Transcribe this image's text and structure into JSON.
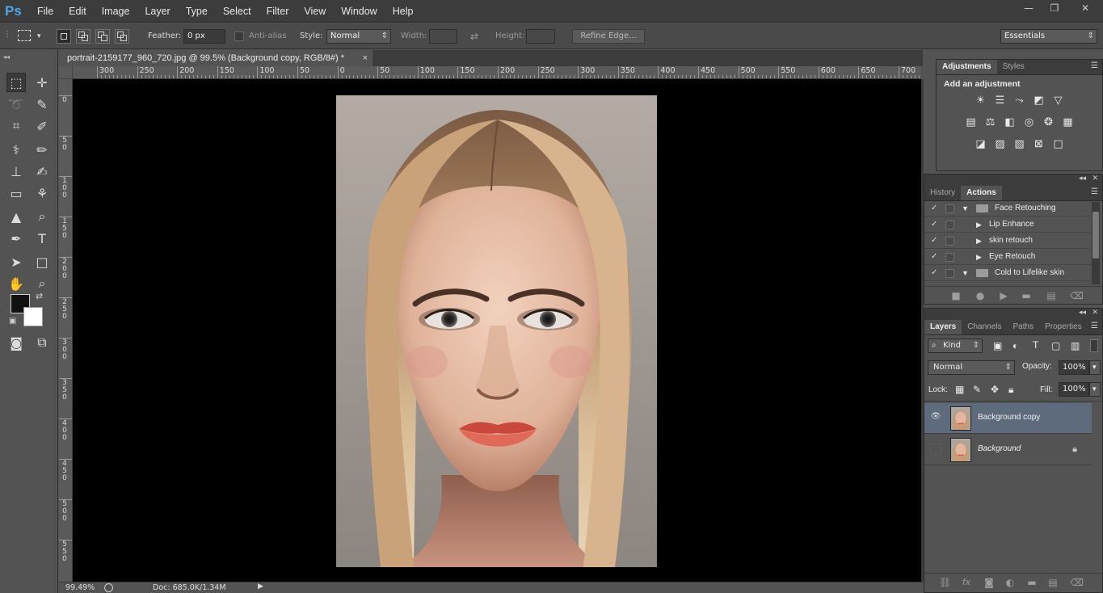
{
  "app": {
    "logo": "Ps"
  },
  "menu": [
    "File",
    "Edit",
    "Image",
    "Layer",
    "Type",
    "Select",
    "Filter",
    "View",
    "Window",
    "Help"
  ],
  "window_controls": {
    "minimize": "—",
    "restore": "❐",
    "close": "✕"
  },
  "options_bar": {
    "feather_label": "Feather:",
    "feather_value": "0 px",
    "antialias_label": "Anti-alias",
    "style_label": "Style:",
    "style_value": "Normal",
    "width_label": "Width:",
    "width_value": "",
    "height_label": "Height:",
    "height_value": "",
    "refine_edge": "Refine Edge...",
    "workspace": "Essentials"
  },
  "document": {
    "tab_title": "portrait-2159177_960_720.jpg @ 99.5% (Background copy, RGB/8#) *",
    "close": "×"
  },
  "ruler_h_labels": [
    "300",
    "250",
    "200",
    "150",
    "100",
    "50",
    "0",
    "50",
    "100",
    "150",
    "200",
    "250",
    "300",
    "350",
    "400",
    "450",
    "500",
    "550",
    "600",
    "650",
    "700"
  ],
  "ruler_v_labels": [
    "0",
    "5\n0",
    "1\n0\n0",
    "1\n5\n0",
    "2\n0\n0",
    "2\n5\n0",
    "3\n0\n0",
    "3\n5\n0",
    "4\n0\n0",
    "4\n5\n0",
    "5\n0\n0",
    "5\n5\n0"
  ],
  "status": {
    "zoom": "99.49%",
    "doc": "Doc: 685.0K/1.34M",
    "arrow": "▶"
  },
  "tools": [
    {
      "name": "rectangular-marquee-icon",
      "glyph": "⬚"
    },
    {
      "name": "move-icon",
      "glyph": "✛"
    },
    {
      "name": "lasso-icon",
      "glyph": "➰"
    },
    {
      "name": "quick-selection-icon",
      "glyph": "✎"
    },
    {
      "name": "crop-icon",
      "glyph": "⌗"
    },
    {
      "name": "eyedropper-icon",
      "glyph": "✐"
    },
    {
      "name": "spot-healing-icon",
      "glyph": "⚕"
    },
    {
      "name": "brush-icon",
      "glyph": "✏"
    },
    {
      "name": "clone-stamp-icon",
      "glyph": "⊥"
    },
    {
      "name": "history-brush-icon",
      "glyph": "✍"
    },
    {
      "name": "eraser-icon",
      "glyph": "▭"
    },
    {
      "name": "paint-bucket-icon",
      "glyph": "⚘"
    },
    {
      "name": "blur-icon",
      "glyph": "▲"
    },
    {
      "name": "dodge-icon",
      "glyph": "⌕"
    },
    {
      "name": "pen-icon",
      "glyph": "✒"
    },
    {
      "name": "type-icon",
      "glyph": "T"
    },
    {
      "name": "path-selection-icon",
      "glyph": "➤"
    },
    {
      "name": "rectangle-shape-icon",
      "glyph": "□"
    },
    {
      "name": "hand-icon",
      "glyph": "✋"
    },
    {
      "name": "zoom-icon",
      "glyph": "⌕"
    },
    {
      "name": "quick-mask-icon",
      "glyph": "◙"
    },
    {
      "name": "screen-mode-icon",
      "glyph": "⧉"
    }
  ],
  "colors": {
    "foreground": "#111111",
    "background": "#ffffff",
    "swap": "⇄",
    "default": "▣",
    "selected_layer": "#5d6b7d"
  },
  "adjustments": {
    "tabs": [
      "Adjustments",
      "Styles"
    ],
    "title": "Add an adjustment",
    "icons": [
      {
        "name": "brightness-contrast-icon",
        "glyph": "☀"
      },
      {
        "name": "levels-icon",
        "glyph": "☰"
      },
      {
        "name": "curves-icon",
        "glyph": "⤳"
      },
      {
        "name": "exposure-icon",
        "glyph": "◩"
      },
      {
        "name": "vibrance-icon",
        "glyph": "▽"
      },
      {
        "name": "hue-saturation-icon",
        "glyph": "▤"
      },
      {
        "name": "color-balance-icon",
        "glyph": "⚖"
      },
      {
        "name": "black-white-icon",
        "glyph": "◧"
      },
      {
        "name": "photo-filter-icon",
        "glyph": "◎"
      },
      {
        "name": "channel-mixer-icon",
        "glyph": "❂"
      },
      {
        "name": "color-lookup-icon",
        "glyph": "▦"
      },
      {
        "name": "invert-icon",
        "glyph": "◪"
      },
      {
        "name": "posterize-icon",
        "glyph": "▨"
      },
      {
        "name": "threshold-icon",
        "glyph": "▧"
      },
      {
        "name": "gradient-map-icon",
        "glyph": "⊠"
      },
      {
        "name": "selective-color-icon",
        "glyph": "□"
      }
    ]
  },
  "actions": {
    "tabs": [
      "History",
      "Actions"
    ],
    "rows": [
      {
        "label": "Face Retouching",
        "kind": "set",
        "check": "✓",
        "tri": "▼"
      },
      {
        "label": "Lip Enhance",
        "kind": "action",
        "check": "✓",
        "tri": "▶"
      },
      {
        "label": "skin retouch",
        "kind": "action",
        "check": "✓",
        "tri": "▶"
      },
      {
        "label": "Eye Retouch",
        "kind": "action",
        "check": "✓",
        "tri": "▶"
      },
      {
        "label": "Cold to Lifelike skin",
        "kind": "set",
        "check": "✓",
        "tri": "▼"
      }
    ],
    "footer": [
      "stop-icon",
      "record-icon",
      "play-icon",
      "new-set-icon",
      "new-action-icon",
      "delete-icon"
    ]
  },
  "layers": {
    "tabs": [
      "Layers",
      "Channels",
      "Paths",
      "Properties"
    ],
    "filter_kind": "Kind",
    "blend_mode": "Normal",
    "opacity_label": "Opacity:",
    "opacity_value": "100%",
    "lock_label": "Lock:",
    "fill_label": "Fill:",
    "fill_value": "100%",
    "items": [
      {
        "name": "Background copy",
        "visible": true,
        "selected": true,
        "locked": false
      },
      {
        "name": "Background",
        "visible": false,
        "selected": false,
        "locked": true
      }
    ],
    "footer": [
      "link-icon",
      "fx-icon",
      "mask-icon",
      "adjustment-layer-icon",
      "group-icon",
      "new-layer-icon",
      "delete-icon"
    ]
  }
}
